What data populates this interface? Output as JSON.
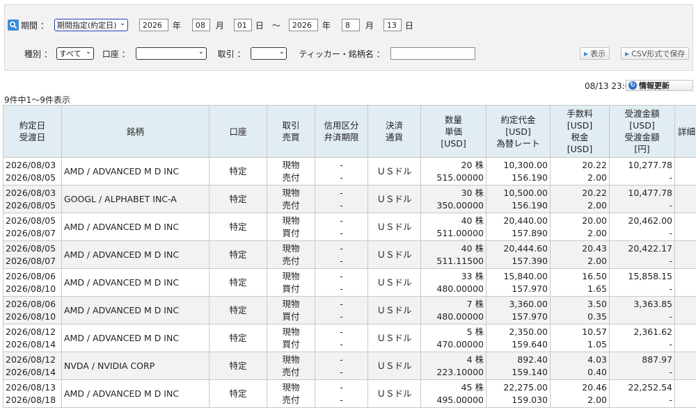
{
  "filter": {
    "period_label": "期間 ：",
    "period_type": "期間指定(約定日)",
    "from_year": "2026",
    "year_unit": "年",
    "from_month": "08",
    "month_unit": "月",
    "from_day": "01",
    "day_unit": "日",
    "tilde": "〜",
    "to_year": "2026",
    "to_month": "8",
    "to_day": "13",
    "kind_label": "種別 ：",
    "kind_value": "すべて",
    "account_label": "口座 ：",
    "account_value": "",
    "trade_label": "取引 ：",
    "trade_value": "",
    "ticker_label": "ティッカー・銘柄名 ：",
    "ticker_value": "",
    "show_button": "表示",
    "csv_button": "CSV形式で保存"
  },
  "result": {
    "count_text": "9件中1〜9件表示",
    "timestamp": "08/13 23:01",
    "refresh_button": "情報更新"
  },
  "table": {
    "headers": {
      "date": [
        "約定日",
        "受渡日"
      ],
      "name": "銘柄",
      "account": "口座",
      "trade": [
        "取引",
        "売買"
      ],
      "credit": [
        "信用区分",
        "弁済期限"
      ],
      "currency": [
        "決済",
        "通貨"
      ],
      "qty": [
        "数量",
        "単価",
        "[USD]"
      ],
      "amount": [
        "約定代金",
        "[USD]",
        "為替レート"
      ],
      "fee": [
        "手数料",
        "[USD]",
        "税金",
        "[USD]"
      ],
      "settle": [
        "受渡金額",
        "[USD]",
        "受渡金額",
        "[円]"
      ],
      "detail": "詳細"
    },
    "rows": [
      {
        "trade_date": "2026/08/03",
        "settle_date": "2026/08/05",
        "name": "AMD / ADVANCED M D INC",
        "account": "特定",
        "trade": "現物",
        "side": "売付",
        "credit": "-",
        "due": "-",
        "currency": "ＵＳドル",
        "qty": "20 株",
        "price": "515.00000",
        "amount": "10,300.00",
        "fx": "156.190",
        "fee": "20.22",
        "tax": "2.00",
        "usd_total": "10,277.78",
        "jpy_total": "-"
      },
      {
        "trade_date": "2026/08/03",
        "settle_date": "2026/08/05",
        "name": "GOOGL / ALPHABET INC-A",
        "account": "特定",
        "trade": "現物",
        "side": "売付",
        "credit": "-",
        "due": "-",
        "currency": "ＵＳドル",
        "qty": "30 株",
        "price": "350.00000",
        "amount": "10,500.00",
        "fx": "156.190",
        "fee": "20.22",
        "tax": "2.00",
        "usd_total": "10,477.78",
        "jpy_total": "-"
      },
      {
        "trade_date": "2026/08/05",
        "settle_date": "2026/08/07",
        "name": "AMD / ADVANCED M D INC",
        "account": "特定",
        "trade": "現物",
        "side": "買付",
        "credit": "-",
        "due": "-",
        "currency": "ＵＳドル",
        "qty": "40 株",
        "price": "511.00000",
        "amount": "20,440.00",
        "fx": "157.890",
        "fee": "20.00",
        "tax": "2.00",
        "usd_total": "20,462.00",
        "jpy_total": "-"
      },
      {
        "trade_date": "2026/08/05",
        "settle_date": "2026/08/07",
        "name": "AMD / ADVANCED M D INC",
        "account": "特定",
        "trade": "現物",
        "side": "売付",
        "credit": "-",
        "due": "-",
        "currency": "ＵＳドル",
        "qty": "40 株",
        "price": "511.11500",
        "amount": "20,444.60",
        "fx": "157.390",
        "fee": "20.43",
        "tax": "2.00",
        "usd_total": "20,422.17",
        "jpy_total": "-"
      },
      {
        "trade_date": "2026/08/06",
        "settle_date": "2026/08/10",
        "name": "AMD / ADVANCED M D INC",
        "account": "特定",
        "trade": "現物",
        "side": "買付",
        "credit": "-",
        "due": "-",
        "currency": "ＵＳドル",
        "qty": "33 株",
        "price": "480.00000",
        "amount": "15,840.00",
        "fx": "157.970",
        "fee": "16.50",
        "tax": "1.65",
        "usd_total": "15,858.15",
        "jpy_total": "-"
      },
      {
        "trade_date": "2026/08/06",
        "settle_date": "2026/08/10",
        "name": "AMD / ADVANCED M D INC",
        "account": "特定",
        "trade": "現物",
        "side": "買付",
        "credit": "-",
        "due": "-",
        "currency": "ＵＳドル",
        "qty": "7 株",
        "price": "480.00000",
        "amount": "3,360.00",
        "fx": "157.970",
        "fee": "3.50",
        "tax": "0.35",
        "usd_total": "3,363.85",
        "jpy_total": "-"
      },
      {
        "trade_date": "2026/08/12",
        "settle_date": "2026/08/14",
        "name": "AMD / ADVANCED M D INC",
        "account": "特定",
        "trade": "現物",
        "side": "買付",
        "credit": "-",
        "due": "-",
        "currency": "ＵＳドル",
        "qty": "5 株",
        "price": "470.00000",
        "amount": "2,350.00",
        "fx": "159.640",
        "fee": "10.57",
        "tax": "1.05",
        "usd_total": "2,361.62",
        "jpy_total": "-"
      },
      {
        "trade_date": "2026/08/12",
        "settle_date": "2026/08/14",
        "name": "NVDA / NVIDIA CORP",
        "account": "特定",
        "trade": "現物",
        "side": "売付",
        "credit": "-",
        "due": "-",
        "currency": "ＵＳドル",
        "qty": "4 株",
        "price": "223.10000",
        "amount": "892.40",
        "fx": "159.140",
        "fee": "4.03",
        "tax": "0.40",
        "usd_total": "887.97",
        "jpy_total": "-"
      },
      {
        "trade_date": "2026/08/13",
        "settle_date": "2026/08/18",
        "name": "AMD / ADVANCED M D INC",
        "account": "特定",
        "trade": "現物",
        "side": "売付",
        "credit": "-",
        "due": "-",
        "currency": "ＵＳドル",
        "qty": "45 株",
        "price": "495.00000",
        "amount": "22,275.00",
        "fx": "159.030",
        "fee": "20.46",
        "tax": "2.00",
        "usd_total": "22,252.54",
        "jpy_total": "-"
      }
    ]
  }
}
